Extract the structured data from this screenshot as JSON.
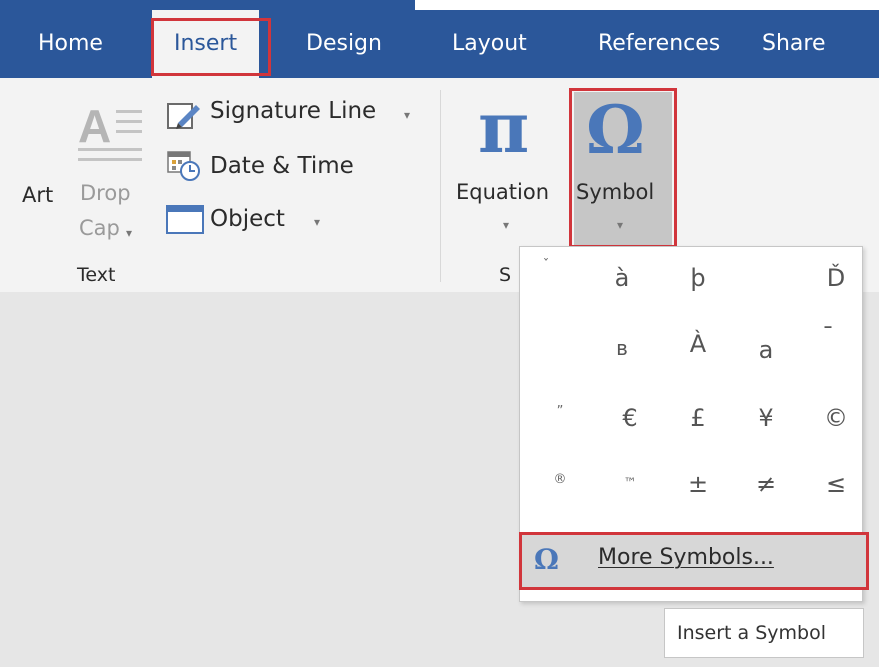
{
  "tabs": {
    "home": "Home",
    "insert": "Insert",
    "design": "Design",
    "layout": "Layout",
    "references": "References",
    "share": "Share"
  },
  "ribbon": {
    "art_partial": "Art",
    "drop_cap_line1": "Drop",
    "drop_cap_line2": "Cap",
    "signature_line": "Signature Line",
    "date_time": "Date & Time",
    "object": "Object",
    "text_group": "Text",
    "equation": "Equation",
    "symbol": "Symbol",
    "symbols_group_partial": "S"
  },
  "symbol_menu": {
    "rows": [
      [
        "ˇ",
        "à",
        "þ",
        "",
        "Ď"
      ],
      [
        "",
        "в",
        "À",
        "a",
        "ˉ"
      ],
      [
        "”",
        "€",
        "£",
        "¥",
        "©"
      ],
      [
        "®",
        "™",
        "±",
        "≠",
        "≤"
      ]
    ],
    "more_symbols": "More Symbols...",
    "more_symbols_mnemonic": "M"
  },
  "tooltip": "Insert a Symbol",
  "icons": {
    "pi": "π",
    "omega": "Ω",
    "drop_cap_letter": "A"
  },
  "colors": {
    "accent": "#2b579a",
    "highlight_box": "#d1353b",
    "icon_blue": "#4a77b9"
  }
}
